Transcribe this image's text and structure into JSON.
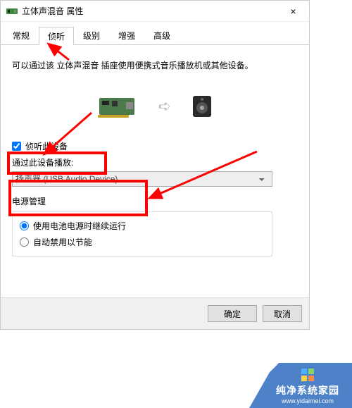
{
  "window": {
    "title": "立体声混音 属性",
    "close_icon": "×"
  },
  "tabs": [
    "常规",
    "侦听",
    "级别",
    "增强",
    "高级"
  ],
  "active_tab_index": 1,
  "description": "可以通过该 立体声混音 插座使用便携式音乐播放机或其他设备。",
  "listen": {
    "checkbox_label": "侦听此设备",
    "playback_label": "通过此设备播放:",
    "selected_device": "扬声器 (USB Audio Device)"
  },
  "power": {
    "title": "电源管理",
    "option1": "使用电池电源时继续运行",
    "option2": "自动禁用以节能"
  },
  "buttons": {
    "ok": "确定",
    "cancel": "取消"
  },
  "watermark": {
    "brand": "纯净系统家园",
    "url": "www.yidaimei.com"
  }
}
